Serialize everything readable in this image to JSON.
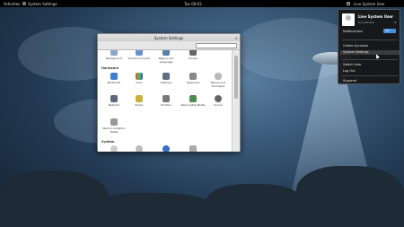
{
  "topbar": {
    "activities": "Activities",
    "app_name": "System Settings",
    "clock": "Tue 09:03",
    "user": "Live System User"
  },
  "window": {
    "title": "System Settings",
    "close": "✕",
    "search_placeholder": "",
    "top_row": [
      "Background",
      "Online Accounts",
      "Region and Language",
      "Screen"
    ],
    "sections": {
      "hardware": "Hardware",
      "system": "System"
    },
    "hardware_items": [
      "Bluetooth",
      "Color",
      "Displays",
      "Keyboard",
      "Mouse and Touchpad",
      "Network",
      "Power",
      "Printers",
      "Removable Media",
      "Sound",
      "Wacom Graphics Tablet"
    ]
  },
  "menu": {
    "user": "Live System User",
    "status": "Unavailable",
    "notifications": "Notifications",
    "toggle": "ON",
    "online_accounts": "Online Accounts",
    "system_settings": "System Settings",
    "switch_user": "Switch User",
    "log_out": "Log Out",
    "suspend": "Suspend"
  }
}
